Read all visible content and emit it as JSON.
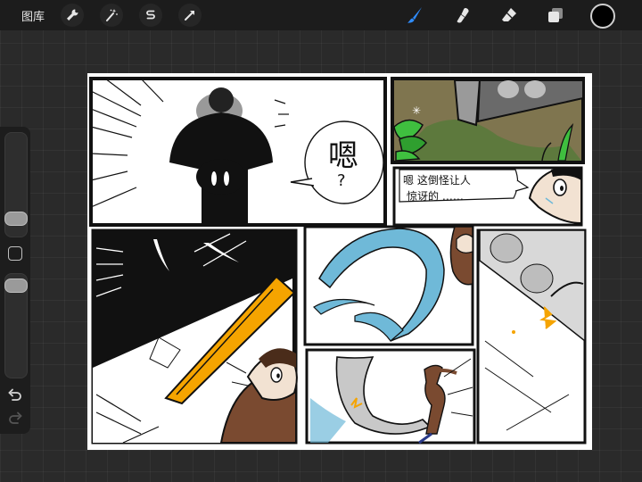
{
  "topbar": {
    "gallery_label": "图库",
    "tools_left": [
      "wrench-icon",
      "magic-wand-icon",
      "selection-icon",
      "transform-arrow-icon"
    ],
    "tools_right": [
      "brush-icon",
      "smudge-icon",
      "eraser-icon",
      "layers-icon"
    ],
    "active_tool": "brush",
    "current_color": "#000000",
    "accent_color": "#2f8cff"
  },
  "sidebar": {
    "brush_size_level": 0.12,
    "opacity_level": 0.95
  },
  "comic": {
    "bubble_hmm": "嗯",
    "bubble_question": "?",
    "caption_line1": "嗯 这倒怪让人",
    "caption_line2": "惊讶的 ……",
    "colors": {
      "ink": "#111111",
      "beak": "#f5a400",
      "water": "#6fb9d8",
      "plant": "#3fbf3f",
      "skin": "#7a4a30"
    }
  }
}
